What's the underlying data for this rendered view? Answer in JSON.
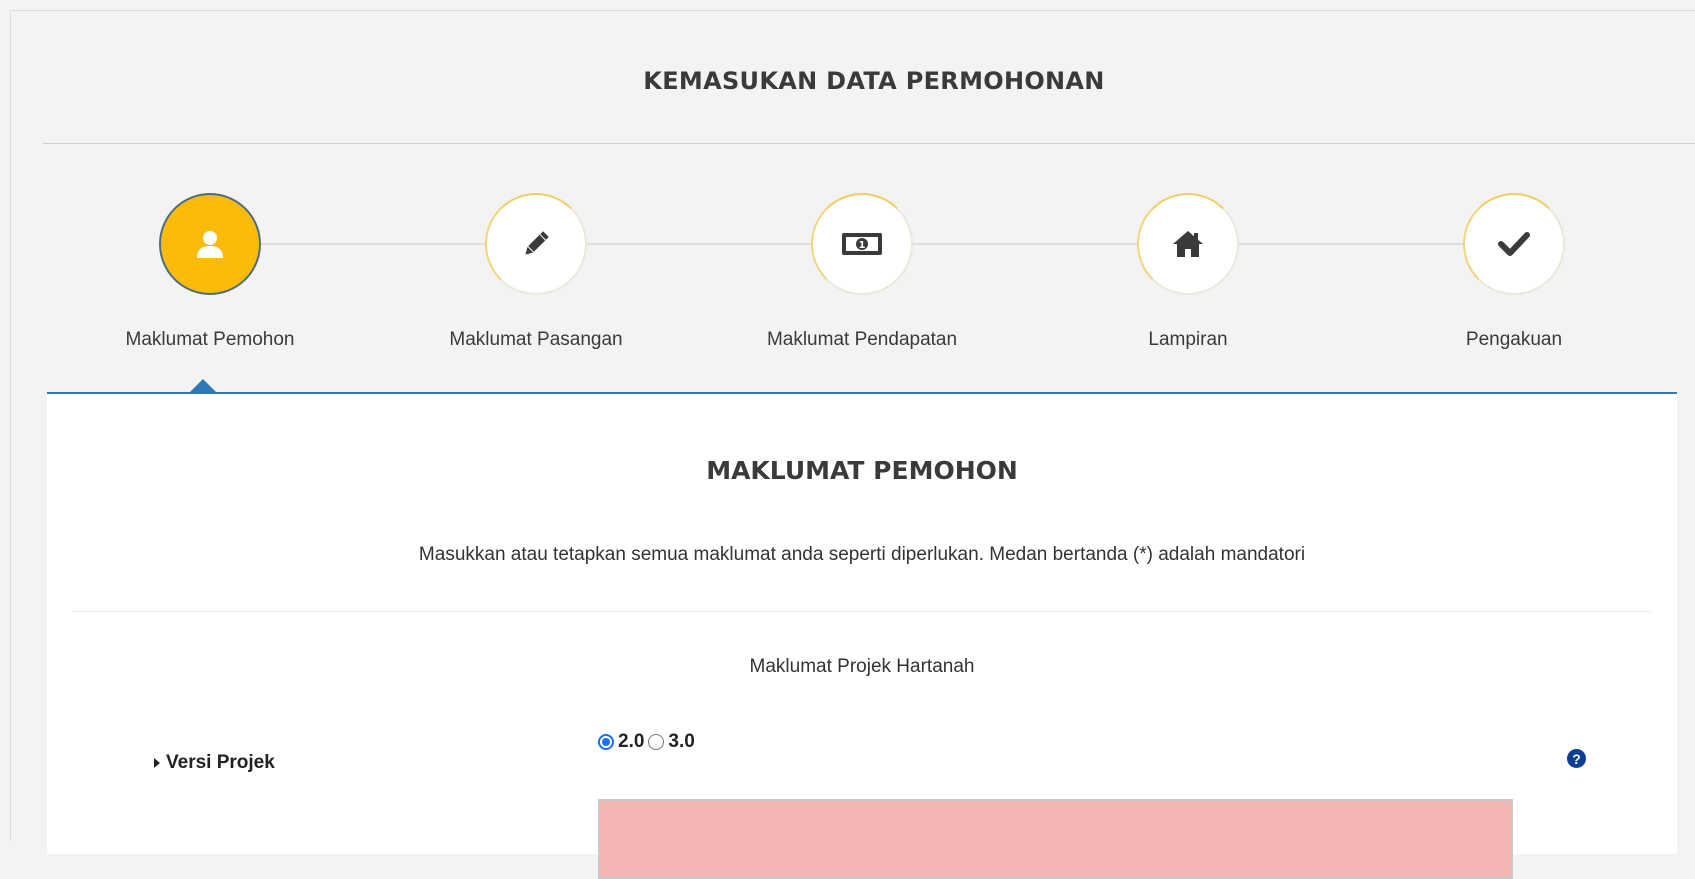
{
  "header": {
    "title": "KEMASUKAN DATA PERMOHONAN"
  },
  "steps": [
    {
      "label": "Maklumat Pemohon",
      "icon": "user-icon",
      "active": true
    },
    {
      "label": "Maklumat Pasangan",
      "icon": "pencil-icon",
      "active": false
    },
    {
      "label": "Maklumat Pendapatan",
      "icon": "money-icon",
      "active": false
    },
    {
      "label": "Lampiran",
      "icon": "home-icon",
      "active": false
    },
    {
      "label": "Pengakuan",
      "icon": "checkmark-icon",
      "active": false
    }
  ],
  "form": {
    "section_title": "MAKLUMAT PEMOHON",
    "instructions": "Masukkan atau tetapkan semua maklumat anda seperti diperlukan. Medan bertanda (*) adalah mandatori",
    "sub_heading": "Maklumat Projek Hartanah",
    "versi_projek": {
      "label": "Versi Projek",
      "options": [
        {
          "label": "2.0",
          "checked": true
        },
        {
          "label": "3.0",
          "checked": false
        }
      ],
      "help_glyph": "?"
    }
  },
  "colors": {
    "accent": "#fbbb0b",
    "panel_border": "#2e79b8",
    "error_fill": "#f4b5b5",
    "radio_selected": "#1a73e8"
  }
}
